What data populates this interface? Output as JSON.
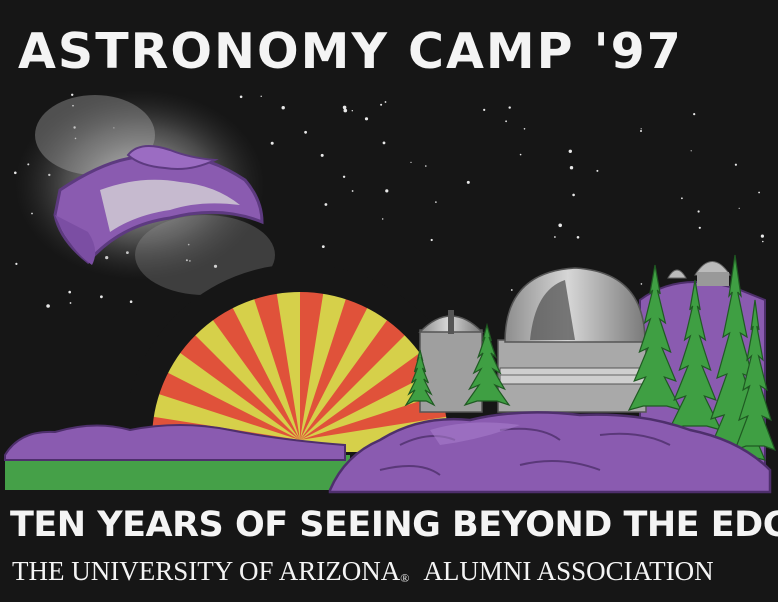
{
  "title": "ASTRONOMY CAMP '97",
  "tagline": "TEN YEARS OF SEEING BEYOND THE EDGE",
  "footer": {
    "university": "THE UNIVERSITY OF ARIZONA",
    "registered_mark": "®",
    "association": "ALUMNI ASSOCIATION"
  },
  "colors": {
    "background": "#161616",
    "text": "#f4f4f4",
    "purple": "#8a5bb0",
    "sun_red": "#e0523a",
    "sun_yellow": "#d6d04a",
    "tree_green": "#3f9f43",
    "grass_green": "#45a048",
    "dome_gray": "#b8b8b8"
  }
}
